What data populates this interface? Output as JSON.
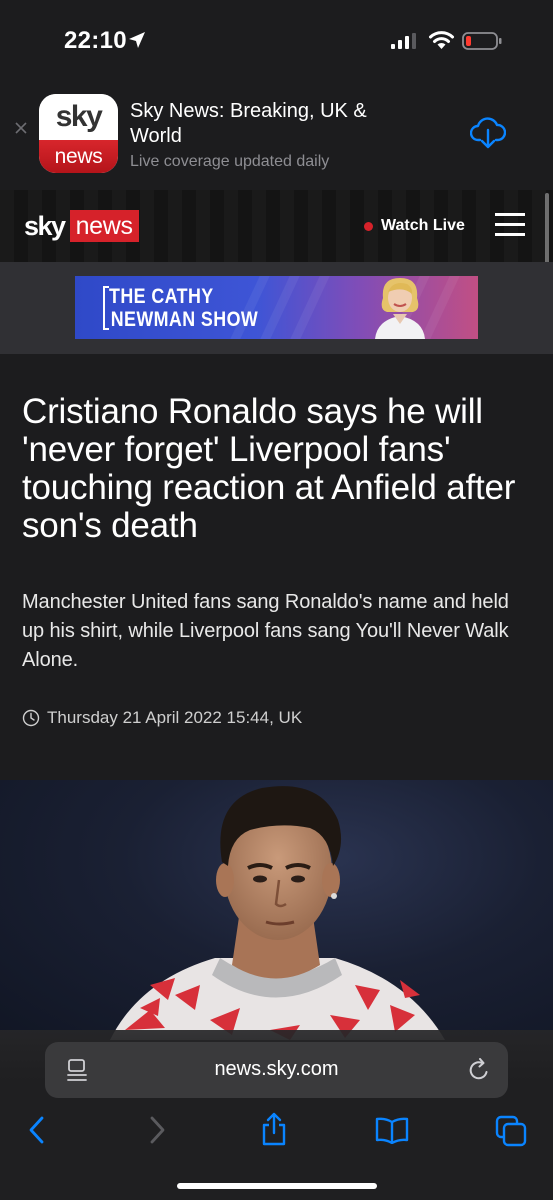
{
  "status_bar": {
    "time": "22:10",
    "icons": [
      "location-arrow-icon",
      "signal-icon",
      "wifi-icon",
      "battery-icon"
    ]
  },
  "app_banner": {
    "icon_top": "sky",
    "icon_bottom": "news",
    "title": "Sky News: Breaking, UK & World",
    "subtitle": "Live coverage updated daily",
    "cta_icon": "cloud-download-icon",
    "close_icon": "close-icon"
  },
  "site_header": {
    "logo_sky": "sky",
    "logo_news": "news",
    "watch_live_label": "Watch Live",
    "menu_icon": "hamburger-menu-icon"
  },
  "advert": {
    "line1": "THE CATHY",
    "line2": "NEWMAN SHOW"
  },
  "article": {
    "headline": "Cristiano Ronaldo says he will 'never forget' Liverpool fans' touching reaction at Anfield after son's death",
    "standfirst": "Manchester United fans sang Ronaldo's name and held up his shirt, while Liverpool fans sang You'll Never Walk Alone.",
    "timestamp": "Thursday 21 April 2022 15:44, UK"
  },
  "browser": {
    "url": "news.sky.com",
    "toolbar_icons": [
      "back-icon",
      "forward-icon",
      "share-icon",
      "bookmarks-icon",
      "tabs-icon"
    ]
  },
  "colors": {
    "brand_red": "#d6222a",
    "safari_blue": "#0a84ff",
    "background": "#1c1c1e"
  }
}
